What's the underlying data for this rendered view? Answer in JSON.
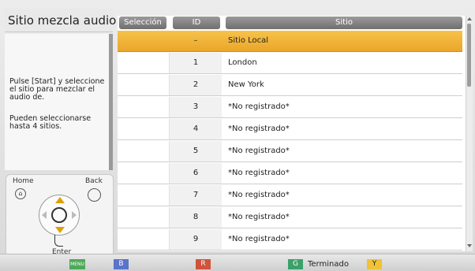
{
  "panel": {
    "title": "Sitio mezcla audio",
    "help_line1": "Pulse [Start] y seleccione el sitio para mezclar el audio de.",
    "help_line2": "Pueden seleccionarse hasta 4 sitios."
  },
  "remote": {
    "home_label": "Home",
    "back_label": "Back",
    "enter_label": "Enter"
  },
  "table": {
    "headers": [
      "Selección",
      "ID",
      "Sitio"
    ],
    "rows": [
      {
        "id": "–",
        "site": "Sitio Local",
        "highlighted": true
      },
      {
        "id": "1",
        "site": "London"
      },
      {
        "id": "2",
        "site": "New York"
      },
      {
        "id": "3",
        "site": "*No registrado*"
      },
      {
        "id": "4",
        "site": "*No registrado*"
      },
      {
        "id": "5",
        "site": "*No registrado*"
      },
      {
        "id": "6",
        "site": "*No registrado*"
      },
      {
        "id": "7",
        "site": "*No registrado*"
      },
      {
        "id": "8",
        "site": "*No registrado*"
      },
      {
        "id": "9",
        "site": "*No registrado*"
      }
    ]
  },
  "bottom_bar": {
    "menu_key": "MENU",
    "b_key": "B",
    "r_key": "R",
    "g_key": "G",
    "g_label": "Terminado",
    "y_key": "Y"
  },
  "colors": {
    "highlight": "#f3b63c",
    "header": "#808080"
  }
}
